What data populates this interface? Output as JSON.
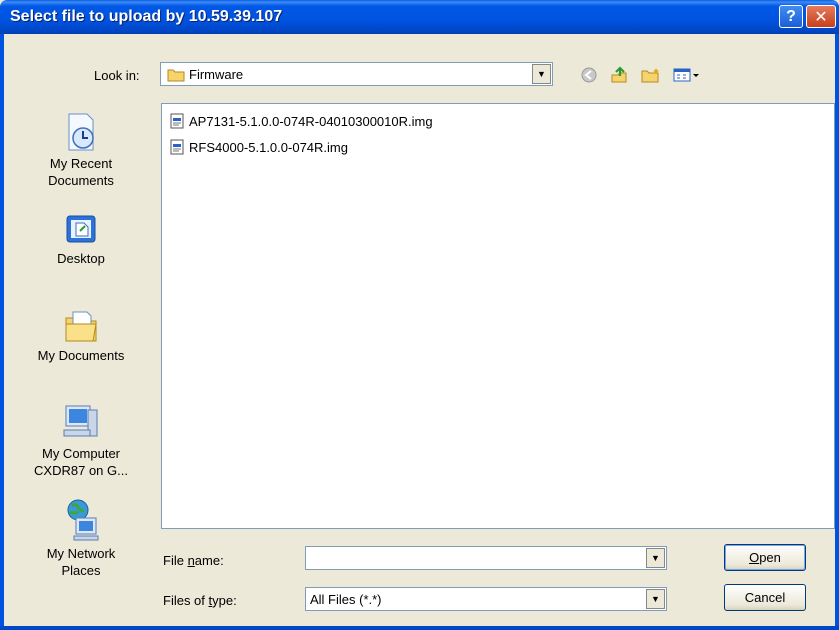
{
  "window": {
    "title": "Select file to upload by 10.59.39.107",
    "help_label": "?",
    "close_label": "✕"
  },
  "look_in": {
    "label": "Look in:",
    "value": "Firmware"
  },
  "places": [
    {
      "label": "My Recent\nDocuments",
      "icon": "recent-documents-icon"
    },
    {
      "label": "Desktop",
      "icon": "desktop-icon"
    },
    {
      "label": "My Documents",
      "icon": "my-documents-icon"
    },
    {
      "label": "My Computer\nCXDR87 on G...",
      "icon": "my-computer-icon"
    },
    {
      "label": "My Network\nPlaces",
      "icon": "network-places-icon"
    }
  ],
  "files": [
    {
      "name": "AP7131-5.1.0.0-074R-04010300010R.img",
      "icon": "file-img-icon"
    },
    {
      "name": "RFS4000-5.1.0.0-074R.img",
      "icon": "file-img-icon"
    }
  ],
  "file_name": {
    "label_pre": "File ",
    "label_u": "n",
    "label_post": "ame:",
    "value": ""
  },
  "file_type": {
    "label_pre": "Files of ",
    "label_u": "t",
    "label_post": "ype:",
    "value": "All Files (*.*)"
  },
  "buttons": {
    "open_u": "O",
    "open_rest": "pen",
    "cancel": "Cancel"
  }
}
